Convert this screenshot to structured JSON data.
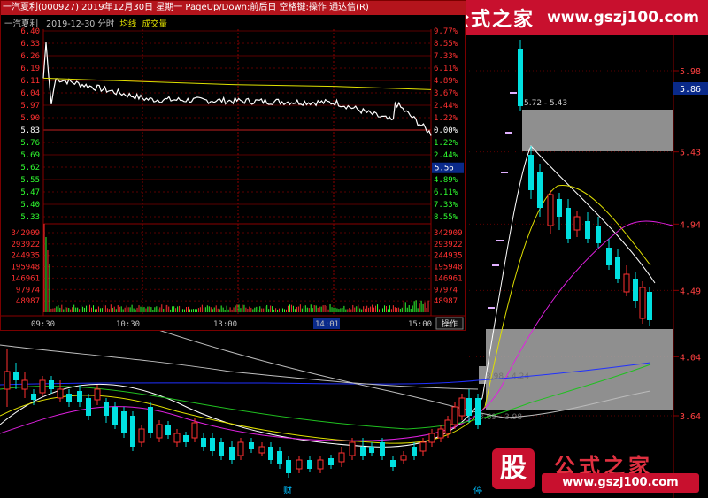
{
  "logo": {
    "name": "公式之家",
    "url": "www.gszj100.com"
  },
  "watermark": {
    "glyph": "股",
    "name": "公式之家",
    "url": "www.gszj100.com"
  },
  "kline": {
    "right_axis": [
      "5.98",
      "5.43",
      "4.94",
      "4.49",
      "4.04",
      "3.64"
    ],
    "current_price": "5.86",
    "zones": [
      {
        "label": "5.72 - 5.43"
      },
      {
        "label": "3.98 - 4.24"
      },
      {
        "label": "3.69 - 3.98"
      }
    ],
    "bottom_marks": [
      "财",
      "停"
    ]
  },
  "intraday": {
    "title": "一汽夏利(000927)  2019年12月30日  星期一  PageUp/Down:前后日  空格键:操作  通达信(R)",
    "stock_name": "一汽夏利",
    "date": "2019-12-30",
    "mode": "分时",
    "avg_line_label": "均线",
    "volume_label": "成交量",
    "left_prices": [
      "6.40",
      "6.33",
      "6.26",
      "6.19",
      "6.11",
      "6.04",
      "5.97",
      "5.90",
      "5.83",
      "5.76",
      "5.69",
      "5.62",
      "5.55",
      "5.47",
      "5.40",
      "5.33"
    ],
    "right_pcts": [
      "9.77%",
      "8.55%",
      "7.33%",
      "6.11%",
      "4.89%",
      "3.67%",
      "2.44%",
      "1.22%",
      "0.00%",
      "1.22%",
      "2.44%",
      "3.67%",
      "4.89%",
      "6.11%",
      "7.33%",
      "8.55%"
    ],
    "volume_ticks": [
      "342909",
      "293922",
      "244935",
      "195948",
      "146961",
      "97974",
      "48987"
    ],
    "time_ticks": [
      "09:30",
      "10:30",
      "13:00",
      "14:01",
      "15:00"
    ],
    "current_price": "5.56",
    "action_label": "操作",
    "colors": {
      "up": "#ff3030",
      "down": "#30ff30",
      "flat": "#ffffff",
      "avg": "#e0e000",
      "price": "#ffffff"
    }
  },
  "chart_data": {
    "type": "line",
    "title": "一汽夏利(000927) 2019-12-30 分时",
    "x": [
      "09:30",
      "10:30",
      "13:00",
      "14:01",
      "15:00"
    ],
    "series": [
      {
        "name": "price",
        "values": [
          6.11,
          5.98,
          5.97,
          5.96,
          5.77
        ]
      },
      {
        "name": "均线",
        "values": [
          6.11,
          6.09,
          6.07,
          6.06,
          6.04
        ]
      }
    ],
    "ylim": [
      5.26,
      6.4
    ],
    "ylabel": "",
    "xlabel": ""
  }
}
